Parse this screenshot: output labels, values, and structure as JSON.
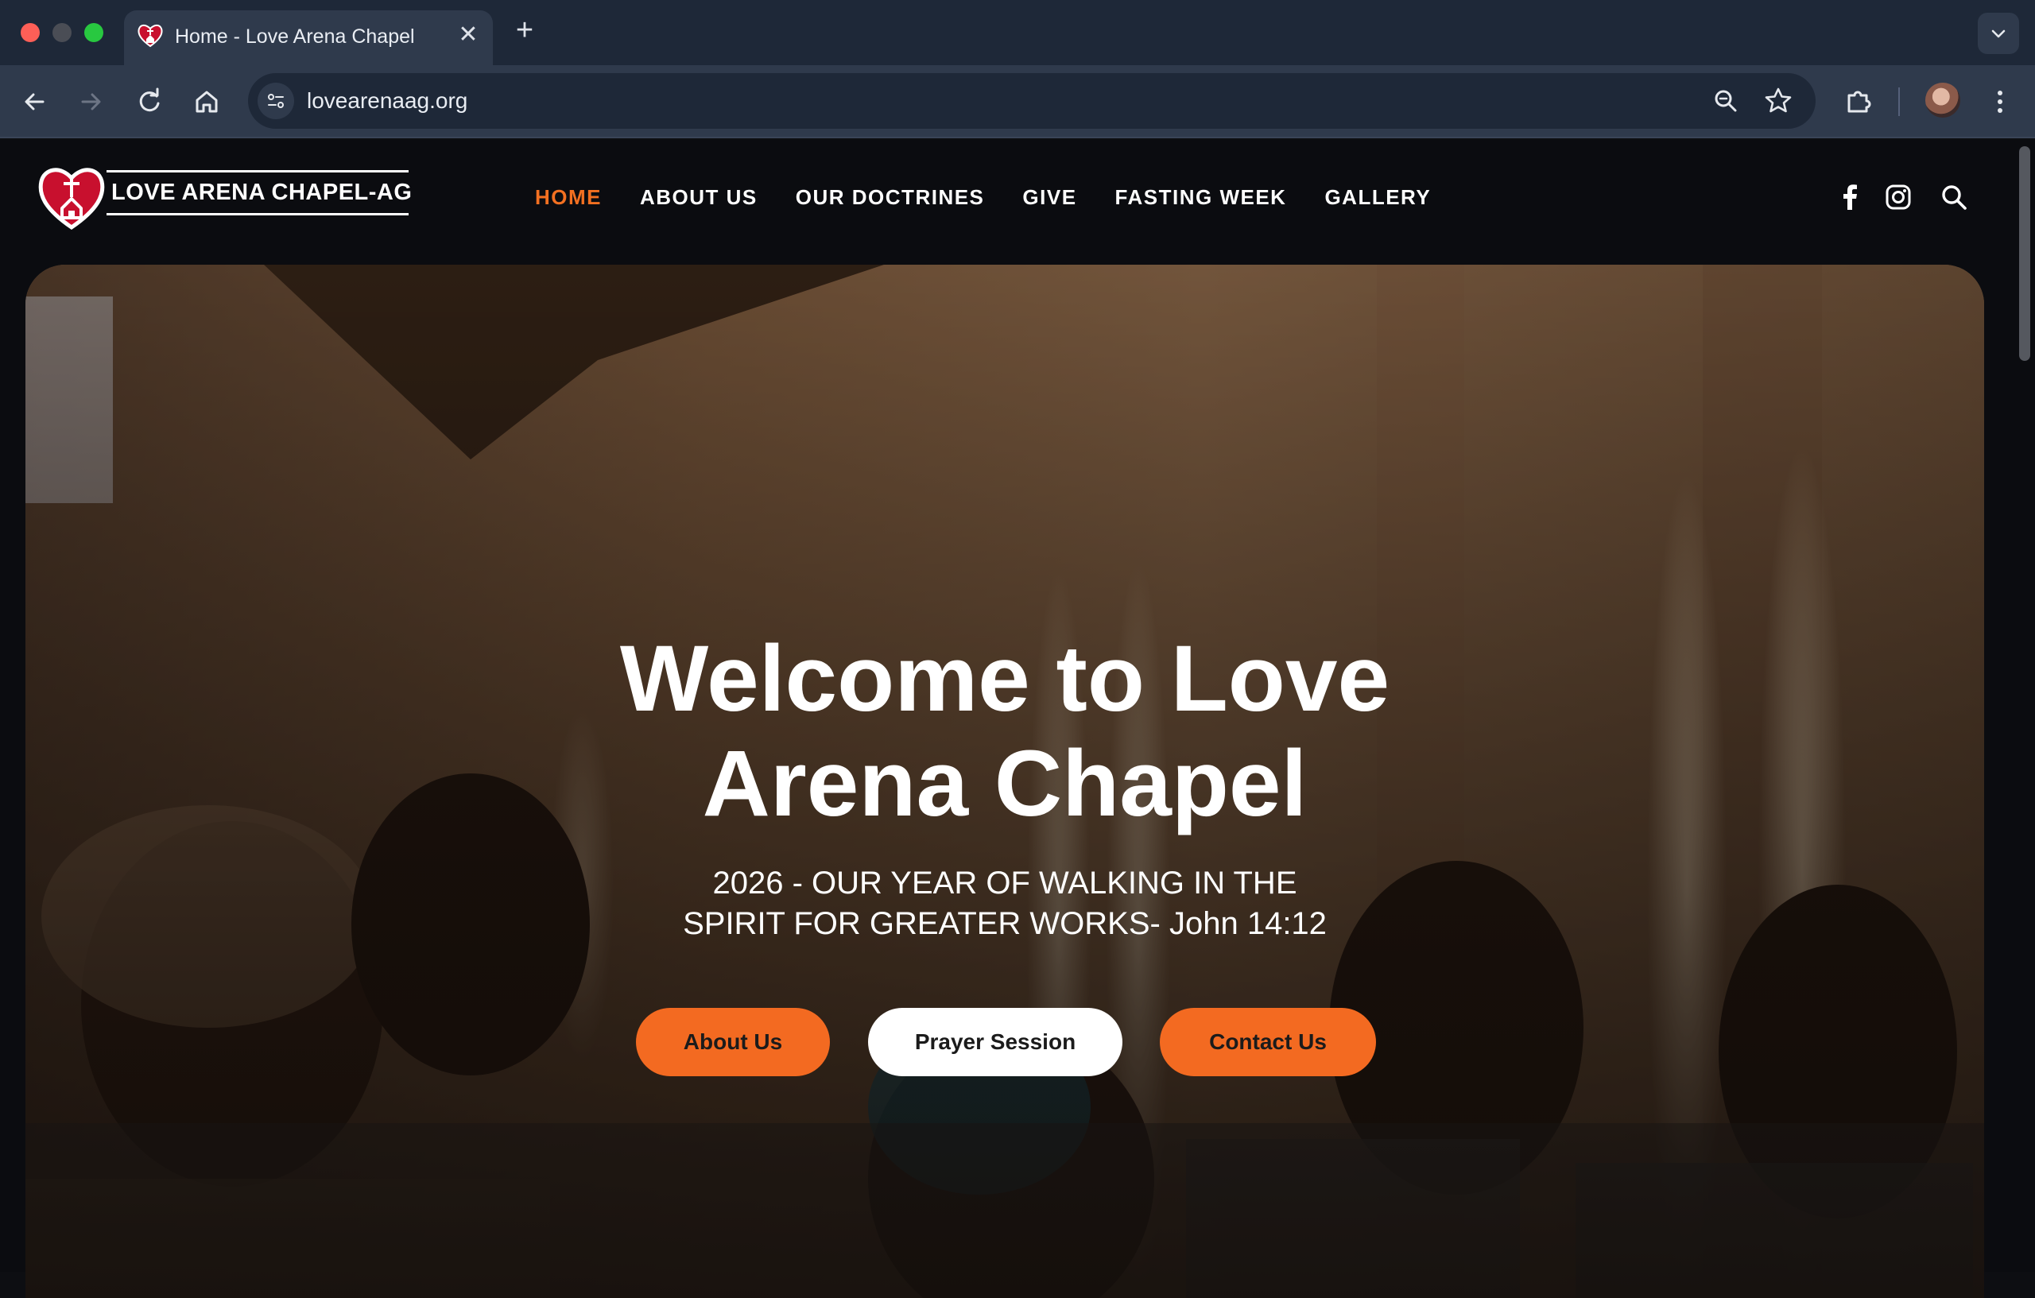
{
  "browser": {
    "tab_title": "Home - Love Arena Chapel",
    "tab_close": "✕",
    "new_tab": "+",
    "url": "lovearenaag.org"
  },
  "site": {
    "logo_text": "LOVE ARENA CHAPEL-AG",
    "nav": [
      {
        "label": "HOME",
        "active": true
      },
      {
        "label": "ABOUT US",
        "active": false
      },
      {
        "label": "OUR DOCTRINES",
        "active": false
      },
      {
        "label": "GIVE",
        "active": false
      },
      {
        "label": "FASTING WEEK",
        "active": false
      },
      {
        "label": "GALLERY",
        "active": false
      }
    ],
    "accent_color": "#f37021"
  },
  "hero": {
    "title_line1": "Welcome to Love",
    "title_line2": "Arena Chapel",
    "subtitle_line1": "2026 - OUR YEAR OF WALKING IN THE",
    "subtitle_line2": "SPIRIT FOR GREATER WORKS- John 14:12",
    "buttons": {
      "about": "About Us",
      "prayer": "Prayer Session",
      "contact": "Contact Us"
    }
  },
  "icons": [
    "back-icon",
    "forward-icon",
    "reload-icon",
    "home-icon",
    "site-info-icon",
    "zoom-icon",
    "bookmark-star-icon",
    "extensions-icon",
    "profile-avatar",
    "more-menu-icon",
    "facebook-icon",
    "instagram-icon",
    "search-icon"
  ]
}
